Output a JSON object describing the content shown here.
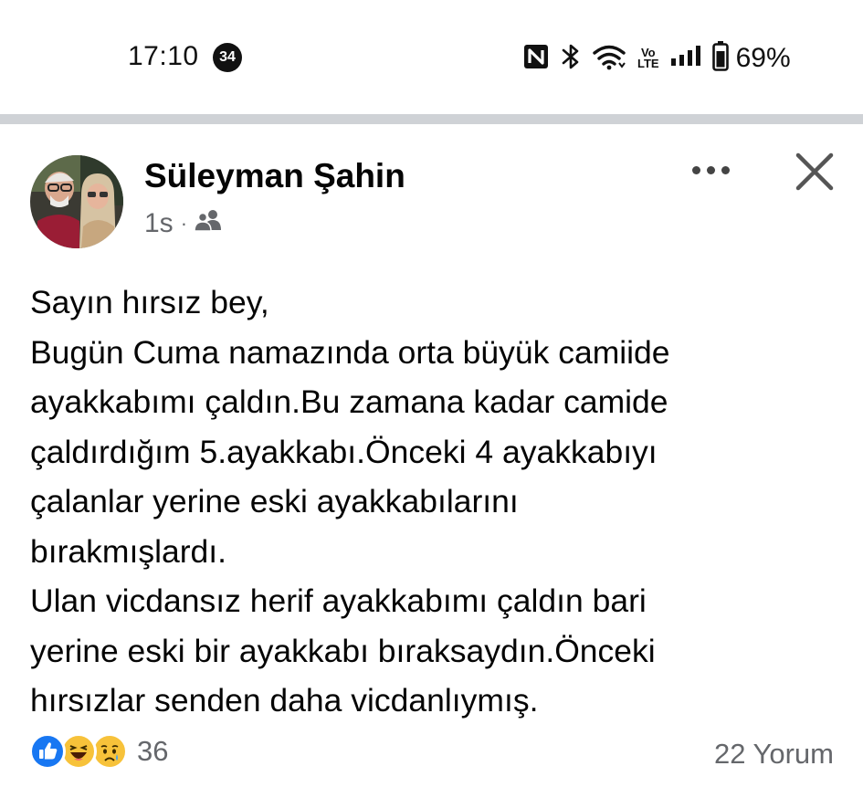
{
  "status_bar": {
    "time": "17:10",
    "notification_badge": "34",
    "icons": [
      "nfc-icon",
      "bluetooth-icon",
      "wifi-icon",
      "volte-icon",
      "signal-icon",
      "battery-icon"
    ],
    "volte_top": "Vo",
    "volte_bottom": "LTE",
    "battery_percent": "69%"
  },
  "post": {
    "author": "Süleyman Şahin",
    "time_ago": "1s",
    "separator": "·",
    "audience_icon": "friends-icon",
    "text_lines": [
      "Sayın hırsız bey,",
      "Bugün Cuma namazında orta büyük camiide",
      "ayakkabımı çaldın.Bu zamana kadar camide",
      "çaldırdığım 5.ayakkabı.Önceki 4 ayakkabıyı",
      "çalanlar yerine eski ayakkabılarını",
      "bırakmışlardı.",
      "Ulan vicdansız herif ayakkabımı çaldın bari",
      "yerine eski bir ayakkabı bıraksaydın.Önceki",
      "hırsızlar senden daha vicdanlıymış."
    ],
    "reaction_icons": [
      "like-icon",
      "haha-icon",
      "sad-icon"
    ],
    "reaction_count": "36",
    "comments": "22 Yorum"
  },
  "colors": {
    "divider": "#cfd2d6",
    "secondary_text": "#65676b",
    "like_blue": "#1877f2",
    "reaction_yellow": "#f7c23a"
  }
}
